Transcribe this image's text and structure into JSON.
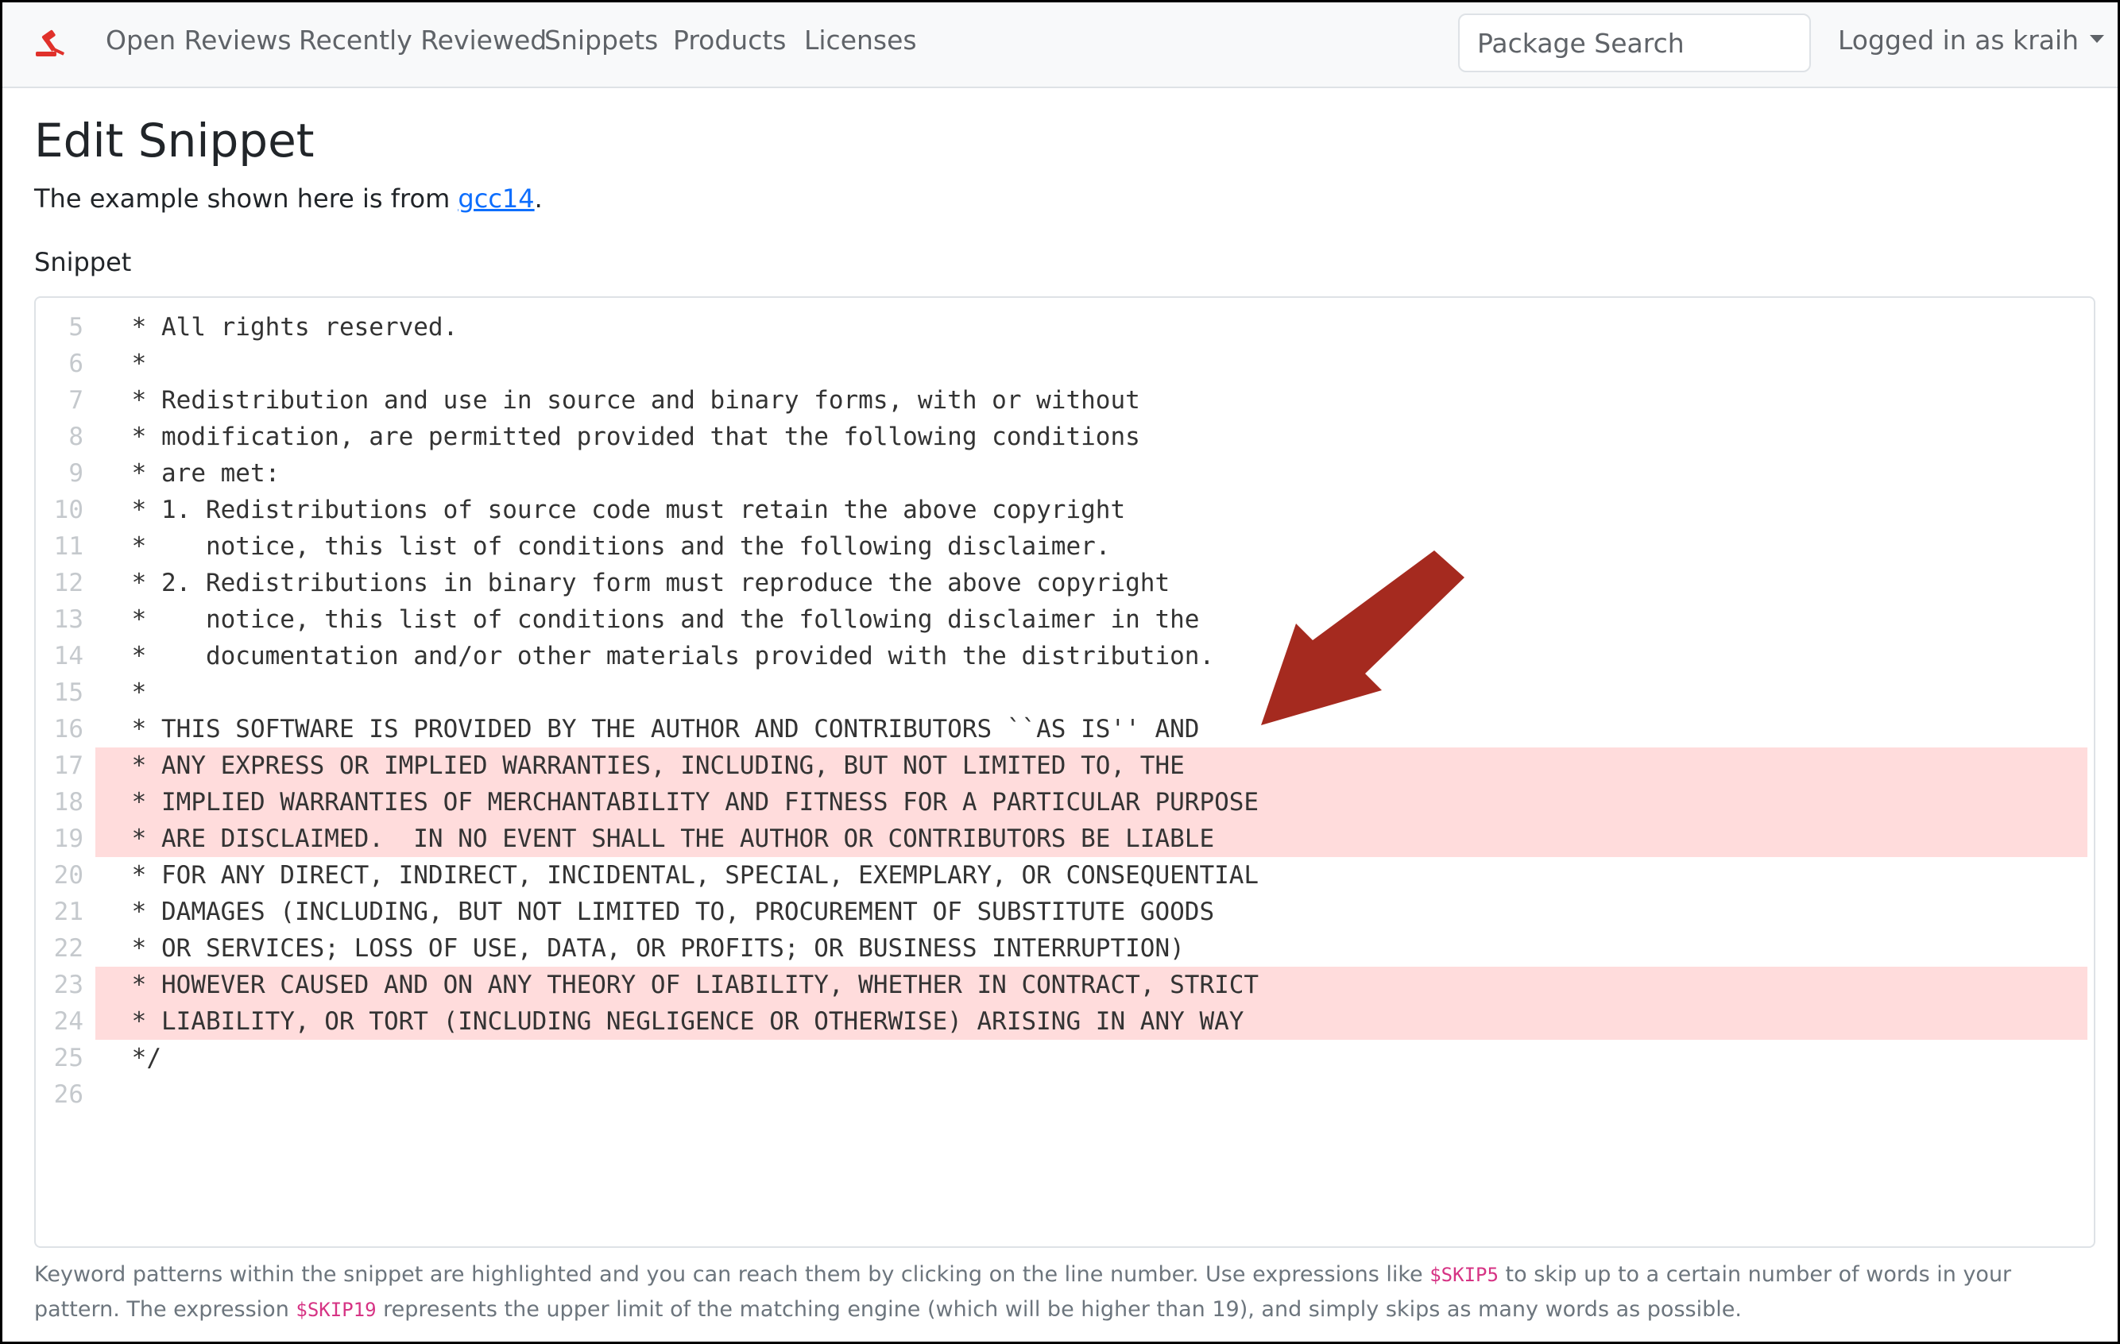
{
  "nav": {
    "links": [
      "Open Reviews",
      "Recently Reviewed",
      "Snippets",
      "Products",
      "Licenses"
    ],
    "search_placeholder": "Package Search",
    "user_label": "Logged in as kraih"
  },
  "page": {
    "title": "Edit Snippet",
    "intro_prefix": "The example shown here is from ",
    "intro_link": "gcc14",
    "intro_suffix": ".",
    "field_label": "Snippet"
  },
  "code": {
    "lines": [
      {
        "num": "5",
        "text": " * All rights reserved.",
        "highlight": false
      },
      {
        "num": "6",
        "text": " *",
        "highlight": false
      },
      {
        "num": "7",
        "text": " * Redistribution and use in source and binary forms, with or without",
        "highlight": false
      },
      {
        "num": "8",
        "text": " * modification, are permitted provided that the following conditions",
        "highlight": false
      },
      {
        "num": "9",
        "text": " * are met:",
        "highlight": false
      },
      {
        "num": "10",
        "text": " * 1. Redistributions of source code must retain the above copyright",
        "highlight": false
      },
      {
        "num": "11",
        "text": " *    notice, this list of conditions and the following disclaimer.",
        "highlight": false
      },
      {
        "num": "12",
        "text": " * 2. Redistributions in binary form must reproduce the above copyright",
        "highlight": false
      },
      {
        "num": "13",
        "text": " *    notice, this list of conditions and the following disclaimer in the",
        "highlight": false
      },
      {
        "num": "14",
        "text": " *    documentation and/or other materials provided with the distribution.",
        "highlight": false
      },
      {
        "num": "15",
        "text": " *",
        "highlight": false
      },
      {
        "num": "16",
        "text": " * THIS SOFTWARE IS PROVIDED BY THE AUTHOR AND CONTRIBUTORS ``AS IS'' AND",
        "highlight": false
      },
      {
        "num": "17",
        "text": " * ANY EXPRESS OR IMPLIED WARRANTIES, INCLUDING, BUT NOT LIMITED TO, THE",
        "highlight": true
      },
      {
        "num": "18",
        "text": " * IMPLIED WARRANTIES OF MERCHANTABILITY AND FITNESS FOR A PARTICULAR PURPOSE",
        "highlight": true
      },
      {
        "num": "19",
        "text": " * ARE DISCLAIMED.  IN NO EVENT SHALL THE AUTHOR OR CONTRIBUTORS BE LIABLE",
        "highlight": true
      },
      {
        "num": "20",
        "text": " * FOR ANY DIRECT, INDIRECT, INCIDENTAL, SPECIAL, EXEMPLARY, OR CONSEQUENTIAL",
        "highlight": false
      },
      {
        "num": "21",
        "text": " * DAMAGES (INCLUDING, BUT NOT LIMITED TO, PROCUREMENT OF SUBSTITUTE GOODS",
        "highlight": false
      },
      {
        "num": "22",
        "text": " * OR SERVICES; LOSS OF USE, DATA, OR PROFITS; OR BUSINESS INTERRUPTION)",
        "highlight": false
      },
      {
        "num": "23",
        "text": " * HOWEVER CAUSED AND ON ANY THEORY OF LIABILITY, WHETHER IN CONTRACT, STRICT",
        "highlight": true
      },
      {
        "num": "24",
        "text": " * LIABILITY, OR TORT (INCLUDING NEGLIGENCE OR OTHERWISE) ARISING IN ANY WAY",
        "highlight": true
      },
      {
        "num": "25",
        "text": " */",
        "highlight": false
      },
      {
        "num": "26",
        "text": "",
        "highlight": false
      }
    ]
  },
  "help": {
    "part1": "Keyword patterns within the snippet are highlighted and you can reach them by clicking on the line number. Use expressions like ",
    "code1": "$SKIP5",
    "part2": " to skip up to a certain number of words in your pattern. The expression ",
    "code2": "$SKIP19",
    "part3": " represents the upper limit of the matching engine (which will be higher than 19), and simply skips as many words as possible."
  },
  "colors": {
    "highlight": "#ffdcdc",
    "arrow": "#a52a1f",
    "link": "#0d6efd",
    "code_keyword": "#d63384",
    "brand": "#e0312b"
  },
  "icons": {
    "brand": "gavel-icon",
    "dropdown": "chevron-down-icon",
    "annotation": "arrow-icon"
  }
}
